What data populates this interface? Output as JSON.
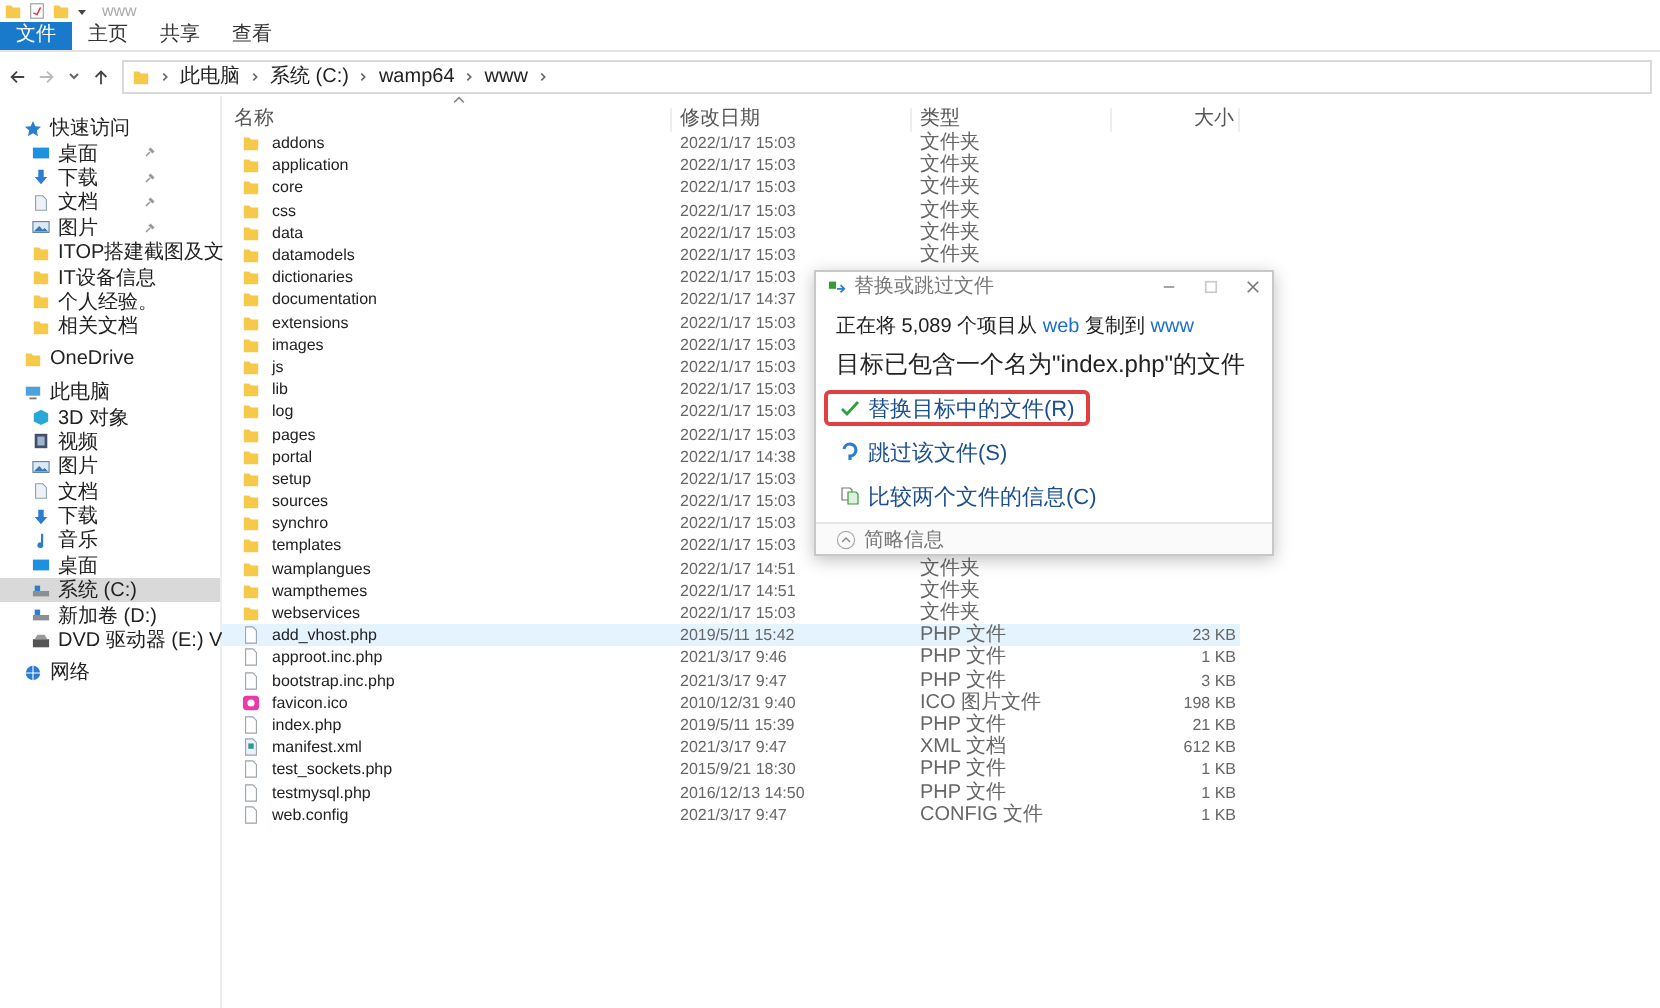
{
  "window": {
    "title": "www"
  },
  "ribbon": {
    "tabs": [
      {
        "label": "文件",
        "selected": true
      },
      {
        "label": "主页",
        "selected": false
      },
      {
        "label": "共享",
        "selected": false
      },
      {
        "label": "查看",
        "selected": false
      }
    ]
  },
  "address": {
    "crumbs": [
      "此电脑",
      "系统 (C:)",
      "wamp64",
      "www"
    ]
  },
  "sidebar": {
    "items": [
      {
        "label": "快速访问",
        "kind": "star",
        "selected": false,
        "children": [
          {
            "label": "桌面",
            "kind": "desktop",
            "pinned": true,
            "selected": false
          },
          {
            "label": "下载",
            "kind": "download",
            "pinned": true,
            "selected": false
          },
          {
            "label": "文档",
            "kind": "document",
            "pinned": true,
            "selected": false
          },
          {
            "label": "图片",
            "kind": "picture",
            "pinned": true,
            "selected": false
          },
          {
            "label": "ITOP搭建截图及文",
            "kind": "folder",
            "pinned": false,
            "selected": false
          },
          {
            "label": "IT设备信息",
            "kind": "folder",
            "pinned": false,
            "selected": false
          },
          {
            "label": "个人经验。",
            "kind": "folder",
            "pinned": false,
            "selected": false
          },
          {
            "label": "相关文档",
            "kind": "folder",
            "pinned": false,
            "selected": false
          }
        ]
      },
      {
        "label": "OneDrive",
        "kind": "folder",
        "selected": false
      },
      {
        "label": "此电脑",
        "kind": "computer",
        "selected": false,
        "children": [
          {
            "label": "3D 对象",
            "kind": "cube",
            "selected": false
          },
          {
            "label": "视频",
            "kind": "video",
            "selected": false
          },
          {
            "label": "图片",
            "kind": "picture",
            "selected": false
          },
          {
            "label": "文档",
            "kind": "document",
            "selected": false
          },
          {
            "label": "下载",
            "kind": "download",
            "selected": false
          },
          {
            "label": "音乐",
            "kind": "music",
            "selected": false
          },
          {
            "label": "桌面",
            "kind": "desktop",
            "selected": false
          },
          {
            "label": "系统 (C:)",
            "kind": "drive",
            "selected": true
          },
          {
            "label": "新加卷 (D:)",
            "kind": "drive",
            "selected": false
          },
          {
            "label": "DVD 驱动器 (E:) V",
            "kind": "dvd",
            "selected": false
          }
        ]
      },
      {
        "label": "网络",
        "kind": "network",
        "selected": false
      }
    ]
  },
  "table": {
    "columns": [
      "名称",
      "修改日期",
      "类型",
      "大小"
    ],
    "rows": [
      {
        "name": "addons",
        "date": "2022/1/17 15:03",
        "type": "文件夹",
        "kind": "folder",
        "selected": false
      },
      {
        "name": "application",
        "date": "2022/1/17 15:03",
        "type": "文件夹",
        "kind": "folder",
        "selected": false
      },
      {
        "name": "core",
        "date": "2022/1/17 15:03",
        "type": "文件夹",
        "kind": "folder",
        "selected": false
      },
      {
        "name": "css",
        "date": "2022/1/17 15:03",
        "type": "文件夹",
        "kind": "folder",
        "selected": false
      },
      {
        "name": "data",
        "date": "2022/1/17 15:03",
        "type": "文件夹",
        "kind": "folder",
        "selected": false
      },
      {
        "name": "datamodels",
        "date": "2022/1/17 15:03",
        "type": "文件夹",
        "kind": "folder",
        "selected": false
      },
      {
        "name": "dictionaries",
        "date": "2022/1/17 15:03",
        "kind": "folder",
        "selected": false
      },
      {
        "name": "documentation",
        "date": "2022/1/17 14:37",
        "kind": "folder",
        "selected": false
      },
      {
        "name": "extensions",
        "date": "2022/1/17 15:03",
        "kind": "folder",
        "selected": false
      },
      {
        "name": "images",
        "date": "2022/1/17 15:03",
        "kind": "folder",
        "selected": false
      },
      {
        "name": "js",
        "date": "2022/1/17 15:03",
        "kind": "folder",
        "selected": false
      },
      {
        "name": "lib",
        "date": "2022/1/17 15:03",
        "kind": "folder",
        "selected": false
      },
      {
        "name": "log",
        "date": "2022/1/17 15:03",
        "kind": "folder",
        "selected": false
      },
      {
        "name": "pages",
        "date": "2022/1/17 15:03",
        "kind": "folder",
        "selected": false
      },
      {
        "name": "portal",
        "date": "2022/1/17 14:38",
        "kind": "folder",
        "selected": false
      },
      {
        "name": "setup",
        "date": "2022/1/17 15:03",
        "kind": "folder",
        "selected": false
      },
      {
        "name": "sources",
        "date": "2022/1/17 15:03",
        "kind": "folder",
        "selected": false
      },
      {
        "name": "synchro",
        "date": "2022/1/17 15:03",
        "kind": "folder",
        "selected": false
      },
      {
        "name": "templates",
        "date": "2022/1/17 15:03",
        "kind": "folder",
        "selected": false
      },
      {
        "name": "wamplangues",
        "date": "2022/1/17 14:51",
        "type": "文件夹",
        "kind": "folder",
        "selected": false
      },
      {
        "name": "wampthemes",
        "date": "2022/1/17 14:51",
        "type": "文件夹",
        "kind": "folder",
        "selected": false
      },
      {
        "name": "webservices",
        "date": "2022/1/17 15:03",
        "type": "文件夹",
        "kind": "folder",
        "selected": false
      },
      {
        "name": "add_vhost.php",
        "date": "2019/5/11 15:42",
        "type": "PHP 文件",
        "size": "23 KB",
        "kind": "file",
        "selected": true
      },
      {
        "name": "approot.inc.php",
        "date": "2021/3/17 9:46",
        "type": "PHP 文件",
        "size": "1 KB",
        "kind": "file",
        "selected": false
      },
      {
        "name": "bootstrap.inc.php",
        "date": "2021/3/17 9:47",
        "type": "PHP 文件",
        "size": "3 KB",
        "kind": "file",
        "selected": false
      },
      {
        "name": "favicon.ico",
        "date": "2010/12/31 9:40",
        "type": "ICO 图片文件",
        "size": "198 KB",
        "kind": "ico",
        "selected": false
      },
      {
        "name": "index.php",
        "date": "2019/5/11 15:39",
        "type": "PHP 文件",
        "size": "21 KB",
        "kind": "file",
        "selected": false
      },
      {
        "name": "manifest.xml",
        "date": "2021/3/17 9:47",
        "type": "XML 文档",
        "size": "612 KB",
        "kind": "xml",
        "selected": false
      },
      {
        "name": "test_sockets.php",
        "date": "2015/9/21 18:30",
        "type": "PHP 文件",
        "size": "1 KB",
        "kind": "file",
        "selected": false
      },
      {
        "name": "testmysql.php",
        "date": "2016/12/13 14:50",
        "type": "PHP 文件",
        "size": "1 KB",
        "kind": "file",
        "selected": false
      },
      {
        "name": "web.config",
        "date": "2021/3/17 9:47",
        "type": "CONFIG 文件",
        "size": "1 KB",
        "kind": "file",
        "selected": false
      }
    ]
  },
  "dialog": {
    "title": "替换或跳过文件",
    "status": {
      "prefix": "正在将 5,089 个项目从",
      "source": "web",
      "middle": "复制到",
      "target": "www"
    },
    "heading": "目标已包含一个名为\"index.php\"的文件",
    "options": [
      {
        "label": "替换目标中的文件(R)",
        "kind": "replace",
        "highlighted": true
      },
      {
        "label": "跳过该文件(S)",
        "kind": "skip",
        "highlighted": false
      },
      {
        "label": "比较两个文件的信息(C)",
        "kind": "compare",
        "highlighted": false
      }
    ],
    "details": "简略信息"
  }
}
